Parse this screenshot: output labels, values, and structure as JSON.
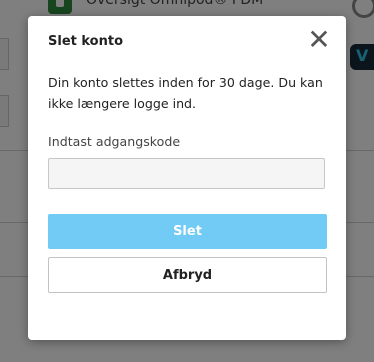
{
  "background": {
    "heading": "Oversigt Omnipod® PDM",
    "right_widget_letter": "V"
  },
  "dialog": {
    "title": "Slet konto",
    "close_glyph": "✕",
    "message": "Din konto slettes inden for 30 dage. Du kan ikke længere logge ind.",
    "password_label": "Indtast adgangskode",
    "password_value": "",
    "delete_label": "Slet",
    "cancel_label": "Afbryd"
  },
  "colors": {
    "delete_button": "#72cbf4",
    "overlay": "rgba(0,0,0,0.5)"
  }
}
